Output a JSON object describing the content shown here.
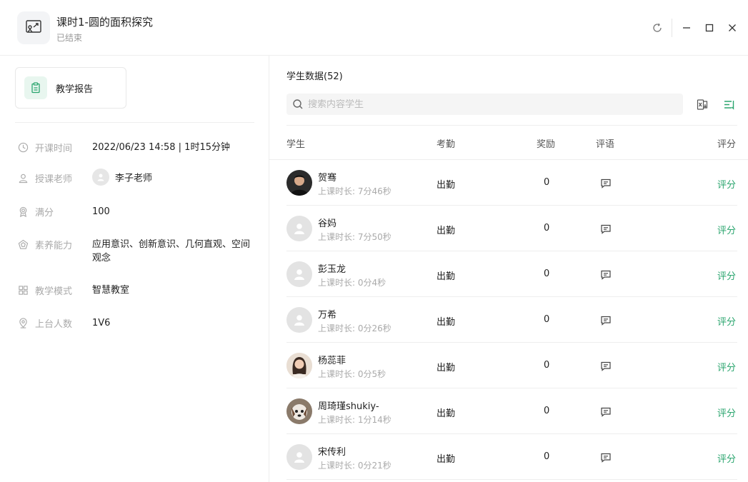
{
  "window": {
    "title": "课时1-圆的面积探究",
    "status": "已结束"
  },
  "left_panel": {
    "report_button": "教学报告",
    "info": [
      {
        "icon": "clock-icon",
        "label": "开课时间",
        "value": "2022/06/23 14:58 | 1时15分钟"
      },
      {
        "icon": "user-icon",
        "label": "授课老师",
        "value": "李子老师"
      },
      {
        "icon": "award-icon",
        "label": "满分",
        "value": "100"
      },
      {
        "icon": "pentagon-icon",
        "label": "素养能力",
        "value": "应用意识、创新意识、几何直观、空间观念"
      },
      {
        "icon": "grid-icon",
        "label": "教学模式",
        "value": "智慧教室"
      },
      {
        "icon": "location-icon",
        "label": "上台人数",
        "value": "1V6"
      }
    ]
  },
  "students": {
    "title": "学生数据(52)",
    "search_placeholder": "搜索内容学生",
    "columns": {
      "student": "学生",
      "attendance": "考勤",
      "reward": "奖励",
      "comment": "评语",
      "score": "评分"
    },
    "rows": [
      {
        "name": "贺骞",
        "duration": "上课时长: 7分46秒",
        "attendance": "出勤",
        "reward": "0",
        "score": "评分",
        "avatar": "photo-male"
      },
      {
        "name": "谷妈",
        "duration": "上课时长: 7分50秒",
        "attendance": "出勤",
        "reward": "0",
        "score": "评分",
        "avatar": "default"
      },
      {
        "name": "彭玉龙",
        "duration": "上课时长: 0分4秒",
        "attendance": "出勤",
        "reward": "0",
        "score": "评分",
        "avatar": "default"
      },
      {
        "name": "万希",
        "duration": "上课时长: 0分26秒",
        "attendance": "出勤",
        "reward": "0",
        "score": "评分",
        "avatar": "default"
      },
      {
        "name": "杨蕊菲",
        "duration": "上课时长: 0分5秒",
        "attendance": "出勤",
        "reward": "0",
        "score": "评分",
        "avatar": "photo-female"
      },
      {
        "name": "周琦瑾shukiy-",
        "duration": "上课时长: 1分14秒",
        "attendance": "出勤",
        "reward": "0",
        "score": "评分",
        "avatar": "photo-dog"
      },
      {
        "name": "宋传利",
        "duration": "上课时长: 0分21秒",
        "attendance": "出勤",
        "reward": "0",
        "score": "评分",
        "avatar": "default"
      }
    ]
  },
  "colors": {
    "accent": "#2aa56e",
    "muted": "#aaaaaa",
    "divider": "#eeeeee"
  }
}
